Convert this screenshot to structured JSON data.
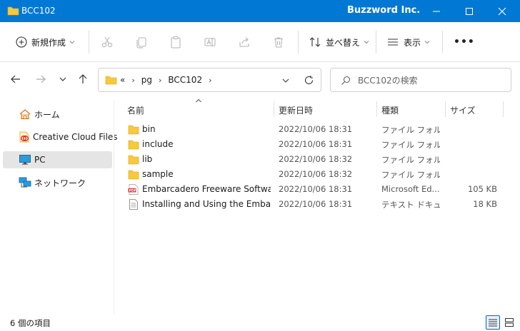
{
  "window": {
    "title": "BCC102",
    "brand": "Buzzword Inc."
  },
  "toolbar": {
    "new_label": "新規作成",
    "sort_label": "並べ替え",
    "view_label": "表示",
    "more_label": "•••"
  },
  "address": {
    "overflow": "«",
    "crumbs": [
      "pg",
      "BCC102"
    ]
  },
  "search": {
    "placeholder": "BCC102の検索"
  },
  "sidebar": {
    "items": [
      {
        "label": "ホーム",
        "icon": "home-icon"
      },
      {
        "label": "Creative Cloud Files",
        "icon": "creative-cloud-icon"
      },
      {
        "label": "PC",
        "icon": "monitor-icon",
        "selected": true
      },
      {
        "label": "ネットワーク",
        "icon": "network-icon"
      }
    ]
  },
  "columns": {
    "name": "名前",
    "date": "更新日時",
    "type": "種類",
    "size": "サイズ"
  },
  "files": [
    {
      "name": "bin",
      "date": "2022/10/06 18:31",
      "type": "ファイル フォルダー",
      "size": "",
      "icon": "folder-icon"
    },
    {
      "name": "include",
      "date": "2022/10/06 18:31",
      "type": "ファイル フォルダー",
      "size": "",
      "icon": "folder-icon"
    },
    {
      "name": "lib",
      "date": "2022/10/06 18:32",
      "type": "ファイル フォルダー",
      "size": "",
      "icon": "folder-icon"
    },
    {
      "name": "sample",
      "date": "2022/10/06 18:32",
      "type": "ファイル フォルダー",
      "size": "",
      "icon": "folder-icon"
    },
    {
      "name": "Embarcadero Freeware Software...",
      "date": "2022/10/06 18:31",
      "type": "Microsoft Ed...",
      "size": "105 KB",
      "icon": "pdf-icon"
    },
    {
      "name": "Installing and Using the Embarc...",
      "date": "2022/10/06 18:31",
      "type": "テキスト ドキュメ...",
      "size": "18 KB",
      "icon": "text-document-icon"
    }
  ],
  "status": {
    "item_count": "6 個の項目"
  },
  "colors": {
    "titlebar": "#0078d4",
    "folder": "#f8c93a",
    "selected": "#e5e5e5",
    "accent": "#0067c0"
  }
}
